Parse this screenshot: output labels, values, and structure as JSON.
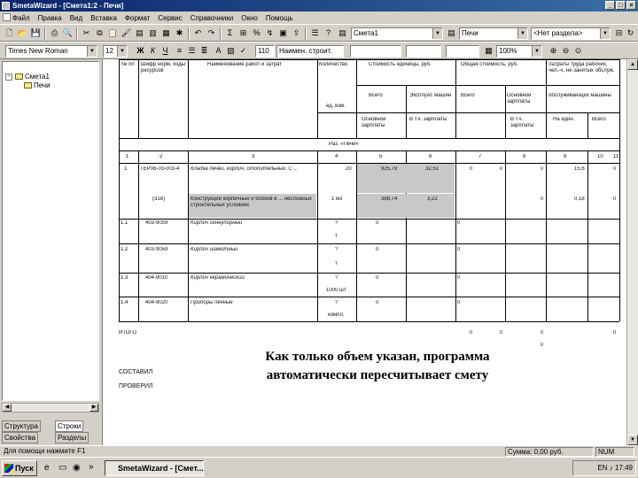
{
  "window": {
    "title": "SmetaWizard - [Смета1:2 - Печи]",
    "buttons": [
      "_",
      "□",
      "×"
    ]
  },
  "menu": [
    "Файл",
    "Правка",
    "Вид",
    "Вставка",
    "Формат",
    "Сервис",
    "Справочники",
    "Окно",
    "Помощь"
  ],
  "toolbar1": {
    "estimate_combo": "Смета1",
    "section_combo": "Печи",
    "subsection_combo": "<Нет раздела>"
  },
  "toolbar2": {
    "font_combo": "Times New Roman",
    "size_combo": "12",
    "bold": "Ж",
    "italic": "К",
    "underline": "Ч",
    "cell_combo": "110",
    "name_combo": "Наимен. строит.",
    "zoom_combo": "100%"
  },
  "tree": {
    "root": "Смета1",
    "child": "Печи"
  },
  "pane_tabs": [
    "Структура",
    "Строки",
    "Свойства",
    "Разделы"
  ],
  "table": {
    "headers": {
      "num": "№ пп",
      "code": "Шифр норм, коды ресурсов",
      "name": "Наименование работ и затрат",
      "qty": "Количество",
      "unit_cost": "Стоимость единицы, руб.",
      "total_cost": "Общая стоимость, руб.",
      "labor": "Затраты труда рабочих, чел.-ч, не занятых обслуж.",
      "unit_label": "ед. изм.",
      "all1": "Всего",
      "exploit1": "Эксплуат. машин",
      "all2": "Всего",
      "main_salary": "Основной зарплаты",
      "exploit2": "Эксплуат. машин",
      "service": "обслуживающих машины",
      "main_salary_b": "Основной зарплаты",
      "incl_salary": "В т.ч. зарплаты",
      "incl_salary2": "В т.ч. зарплаты",
      "per_unit": "На един.",
      "all3": "Всего"
    },
    "section_title": "Раз. «Печи»",
    "col_numbers": [
      "1",
      "2",
      "3",
      "4",
      "5",
      "6",
      "7",
      "8",
      "9",
      "10",
      "11"
    ],
    "rows": [
      {
        "num": "1",
        "code": "ТЕР08-03-003-4",
        "name": "Кладка печей, кирпич, отопительных. С ...",
        "qty": "20",
        "c5": "925,79",
        "c6": "32,51",
        "c7": "0",
        "c8": "0",
        "c9": "0",
        "c10": "15,6",
        "c11": "0"
      },
      {
        "num": "",
        "code": "(318)",
        "name": "Конструкции кирпичные и блоков в ... несложных строительных условиях",
        "qty": "1 м3",
        "c5": "388,74",
        "c6": "3,22",
        "c7": "",
        "c8": "",
        "c9": "0",
        "c10": "0,18",
        "c11": "0"
      },
      {
        "num": "1.1",
        "code": "403-9059",
        "name": "Кирпич огнеупорный",
        "qty": "?",
        "unit": "т",
        "c5": "0",
        "c7": "0"
      },
      {
        "num": "1.2",
        "code": "403-9059",
        "name": "Кирпич шамотный",
        "qty": "?",
        "unit": "т",
        "c5": "0",
        "c7": "0"
      },
      {
        "num": "1.3",
        "code": "404-9010",
        "name": "Кирпич керамический",
        "qty": "?",
        "unit": "1000 шт",
        "c5": "0",
        "c7": "0"
      },
      {
        "num": "1.4",
        "code": "404-9020",
        "name": "Приборы печные",
        "qty": "?",
        "unit": "компл.",
        "c5": "0",
        "c7": "0"
      }
    ],
    "total_label": "ИТОГО",
    "total_values": [
      "0",
      "0",
      "0",
      "0",
      "0"
    ],
    "composed_label": "СОСТАВИЛ",
    "checked_label": "ПРОВЕРИЛ"
  },
  "caption": {
    "line1": "Как только объем указан, программа",
    "line2": "автоматически пересчитывает смету"
  },
  "status": {
    "hint": "Для помощи нажмите F1",
    "cost": "Сумма: 0,00 руб.",
    "mode": "NUM"
  },
  "taskbar": {
    "start": "Пуск",
    "task": "SmetaWizard - [Смет...",
    "tray_lang": "EN",
    "clock": "17:49"
  }
}
